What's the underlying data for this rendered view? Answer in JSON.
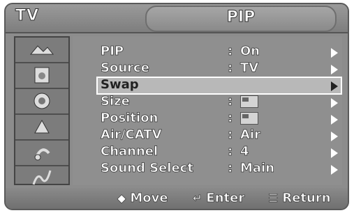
{
  "header": {
    "left_label": "TV",
    "title": "PIP"
  },
  "sidebar": {
    "items": [
      {
        "icon": "picture-icon"
      },
      {
        "icon": "sound-icon"
      },
      {
        "icon": "channel-icon"
      },
      {
        "icon": "setup-icon"
      },
      {
        "icon": "input-icon"
      },
      {
        "icon": "function-icon"
      }
    ]
  },
  "menu": {
    "rows": [
      {
        "label": "PIP",
        "value": "On"
      },
      {
        "label": "Source",
        "value": "TV"
      },
      {
        "label": "Swap",
        "value": ""
      },
      {
        "label": "Size",
        "value": ""
      },
      {
        "label": "Position",
        "value": ""
      },
      {
        "label": "Air/CATV",
        "value": "Air"
      },
      {
        "label": "Channel",
        "value": "4"
      },
      {
        "label": "Sound Select",
        "value": "Main"
      }
    ],
    "selected": "Swap"
  },
  "footer": {
    "move": "Move",
    "enter": "Enter",
    "return": "Return"
  }
}
